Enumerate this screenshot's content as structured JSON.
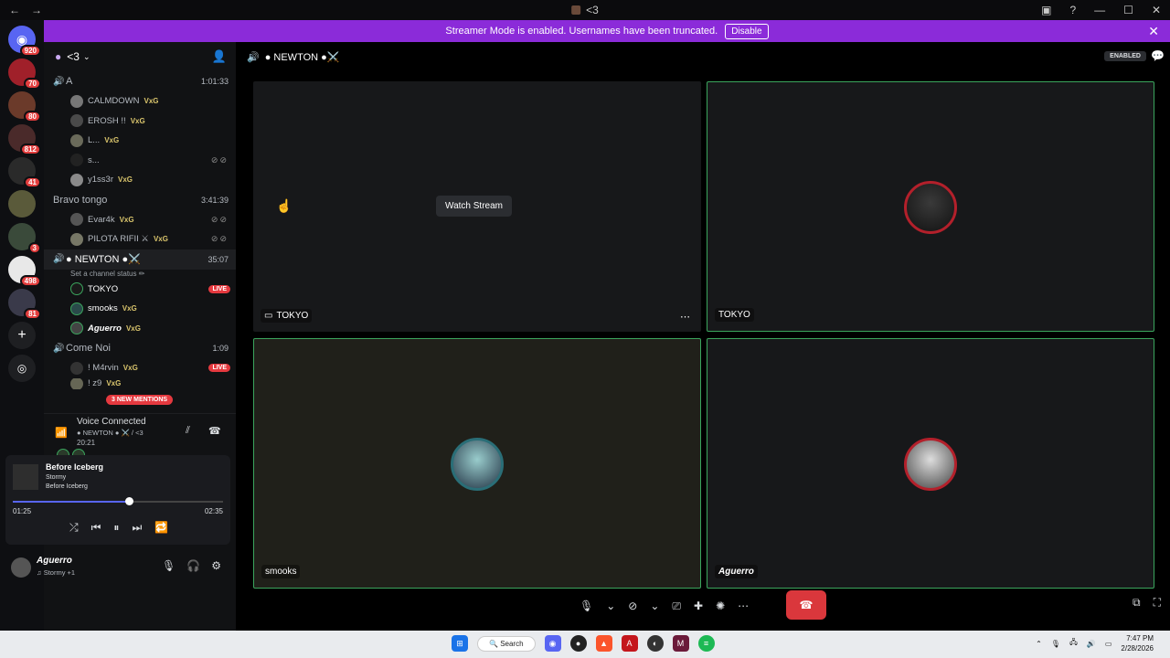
{
  "titlebar": {
    "title": "<3",
    "back": "←",
    "forward": "→"
  },
  "banner": {
    "text": "Streamer Mode is enabled. Usernames have been truncated.",
    "disable_label": "Disable"
  },
  "servers": [
    {
      "badge": "920"
    },
    {
      "badge": "70"
    },
    {
      "badge": "80"
    },
    {
      "badge": "812"
    },
    {
      "badge": "41"
    },
    {
      "badge": ""
    },
    {
      "badge": "3"
    },
    {
      "badge": "498"
    },
    {
      "badge": "81"
    }
  ],
  "guild": {
    "name": "<3"
  },
  "channels": {
    "a": {
      "name": "A",
      "time": "1:01:33",
      "members": [
        "CALMDOWN",
        "EROSH !!",
        "L...",
        "s...",
        "y1ss3r"
      ]
    },
    "bravo": {
      "name": "Bravo tongo",
      "time": "3:41:39",
      "members": [
        "Evar4k",
        "PILOTA RIFII ⚔"
      ]
    },
    "newton": {
      "name": "● NEWTON ●⚔️",
      "time": "35:07",
      "status": "Set a channel status ✏",
      "members": [
        "TOKYO",
        "smooks",
        "Aguerro"
      ],
      "live": "LIVE"
    },
    "come": {
      "name": "Come Noi",
      "time": "1:09",
      "members": [
        "! M4rvin",
        "! z9"
      ],
      "live": "LIVE"
    },
    "tag": "VxG"
  },
  "mentions": "3 NEW MENTIONS",
  "voice": {
    "title": "Voice Connected",
    "channel": "● NEWTON ● ⚔️ / <3",
    "time": "20:21"
  },
  "music": {
    "track": "Before Iceberg",
    "artist": "Stormy",
    "album": "Before Iceberg",
    "elapsed": "01:25",
    "duration": "02:35",
    "progress": 0.55
  },
  "user": {
    "name": "Aguerro",
    "status": "♫ Stormy +1"
  },
  "main": {
    "channel": "● NEWTON ●⚔️",
    "enabled": "ENABLED"
  },
  "tiles": [
    {
      "name": "TOKYO",
      "watch": "Watch Stream"
    },
    {
      "name": "TOKYO"
    },
    {
      "name": "smooks"
    },
    {
      "name": "Aguerro"
    }
  ],
  "taskbar": {
    "search": "Search",
    "time": "7:47 PM",
    "date": "2/28/2026"
  }
}
